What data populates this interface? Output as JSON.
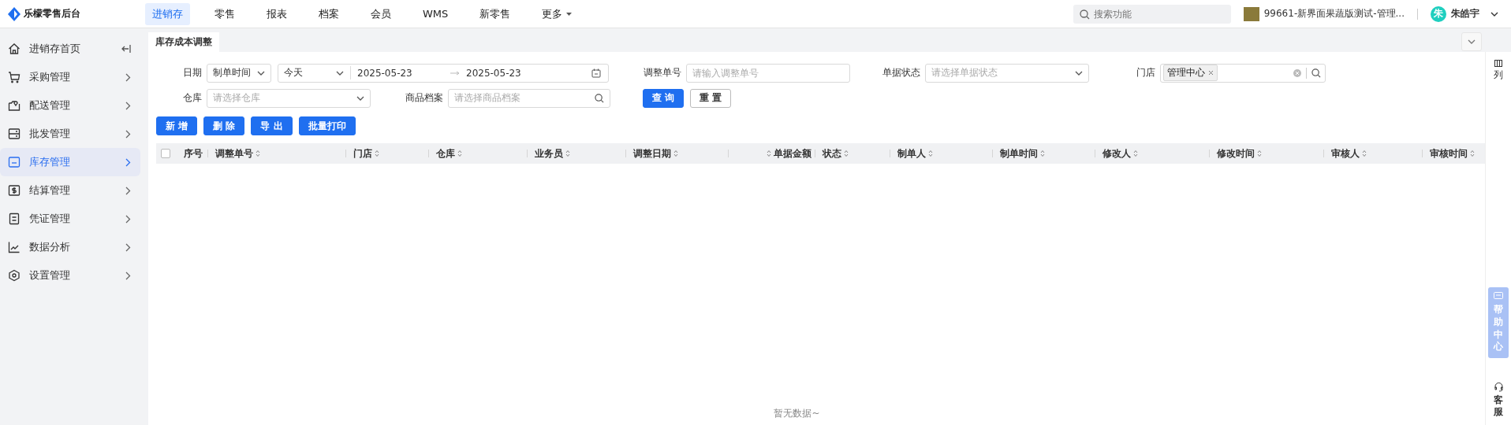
{
  "app": {
    "title": "乐檬零售后台"
  },
  "top_nav": [
    {
      "label": "进销存",
      "selected": true,
      "dropdown": false
    },
    {
      "label": "零售",
      "selected": false,
      "dropdown": false
    },
    {
      "label": "报表",
      "selected": false,
      "dropdown": false
    },
    {
      "label": "档案",
      "selected": false,
      "dropdown": false
    },
    {
      "label": "会员",
      "selected": false,
      "dropdown": false
    },
    {
      "label": "WMS",
      "selected": false,
      "dropdown": false
    },
    {
      "label": "新零售",
      "selected": false,
      "dropdown": false
    },
    {
      "label": "更多",
      "selected": false,
      "dropdown": true
    }
  ],
  "search": {
    "placeholder": "搜索功能"
  },
  "org": {
    "name": "99661-新界面果蔬版测试-管理..."
  },
  "user": {
    "avatar": "朱",
    "name": "朱皓宇"
  },
  "sidebar": {
    "items": [
      {
        "label": "进销存首页",
        "selected": false
      },
      {
        "label": "采购管理",
        "selected": false
      },
      {
        "label": "配送管理",
        "selected": false
      },
      {
        "label": "批发管理",
        "selected": false
      },
      {
        "label": "库存管理",
        "selected": true
      },
      {
        "label": "结算管理",
        "selected": false
      },
      {
        "label": "凭证管理",
        "selected": false
      },
      {
        "label": "数据分析",
        "selected": false
      },
      {
        "label": "设置管理",
        "selected": false
      }
    ]
  },
  "tabs": [
    {
      "label": "库存成本调整",
      "selected": true
    }
  ],
  "filters": {
    "date_label": "日期",
    "date_type": "制单时间",
    "date_preset": "今天",
    "date_from": "2025-05-23",
    "date_to": "2025-05-23",
    "order_no_label": "调整单号",
    "order_no_placeholder": "请输入调整单号",
    "status_label": "单据状态",
    "status_placeholder": "请选择单据状态",
    "store_label": "门店",
    "store_tags": [
      "管理中心"
    ],
    "warehouse_label": "仓库",
    "warehouse_placeholder": "请选择仓库",
    "product_label": "商品档案",
    "product_placeholder": "请选择商品档案",
    "query_button": "查 询",
    "reset_button": "重 置"
  },
  "actions": [
    "新 增",
    "删 除",
    "导 出",
    "批量打印"
  ],
  "table": {
    "checked": false,
    "columns": [
      {
        "label": "序号",
        "sortable": false
      },
      {
        "label": "调整单号",
        "sortable": true
      },
      {
        "label": "门店",
        "sortable": true
      },
      {
        "label": "仓库",
        "sortable": true
      },
      {
        "label": "业务员",
        "sortable": true
      },
      {
        "label": "调整日期",
        "sortable": true
      },
      {
        "label": "单据金额",
        "sortable": true
      },
      {
        "label": "状态",
        "sortable": true
      },
      {
        "label": "制单人",
        "sortable": true
      },
      {
        "label": "制单时间",
        "sortable": true
      },
      {
        "label": "修改人",
        "sortable": true
      },
      {
        "label": "修改时间",
        "sortable": true
      },
      {
        "label": "审核人",
        "sortable": true
      },
      {
        "label": "审核时间",
        "sortable": true
      }
    ],
    "empty_text": "暂无数据~"
  },
  "column_toggle": "列",
  "help_center": "帮助中心",
  "customer_service": "客服"
}
